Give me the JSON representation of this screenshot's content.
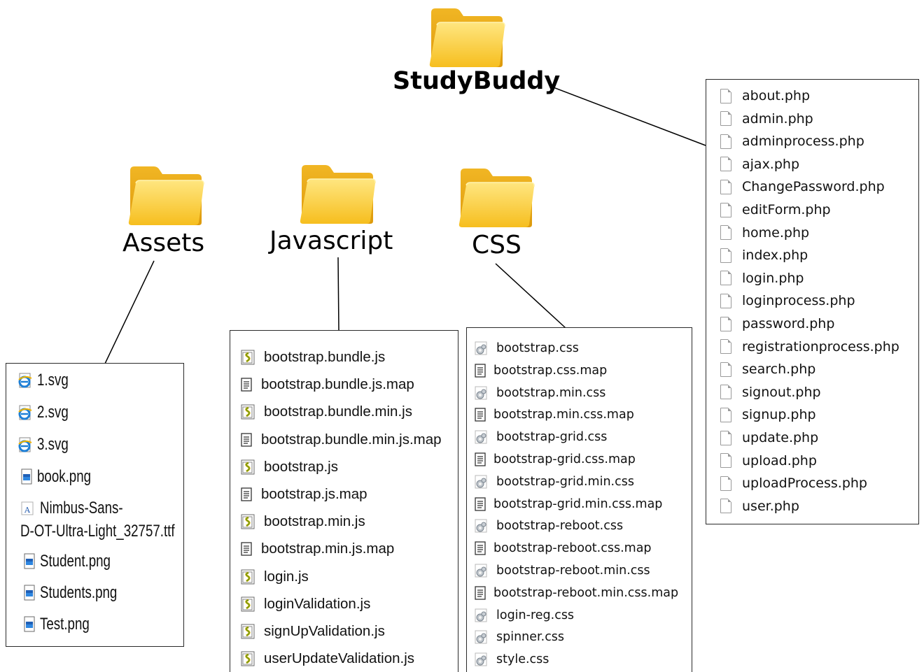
{
  "root": {
    "label": "StudyBuddy"
  },
  "folders": {
    "assets": {
      "label": "Assets"
    },
    "javascript": {
      "label": "Javascript"
    },
    "css": {
      "label": "CSS"
    }
  },
  "root_files": [
    "about.php",
    "admin.php",
    "adminprocess.php",
    "ajax.php",
    "ChangePassword.php",
    "editForm.php",
    "home.php",
    "index.php",
    "login.php",
    "loginprocess.php",
    "password.php",
    "registrationprocess.php",
    "search.php",
    "signout.php",
    "signup.php",
    "update.php",
    "upload.php",
    "uploadProcess.php",
    "user.php"
  ],
  "assets_files": [
    {
      "name": "1.svg",
      "icon": "ie-icon"
    },
    {
      "name": "2.svg",
      "icon": "ie-icon"
    },
    {
      "name": "3.svg",
      "icon": "ie-icon"
    },
    {
      "name": "book.png",
      "icon": "image-file-icon"
    },
    {
      "name": "Nimbus-Sans-",
      "icon": "font-file-icon"
    },
    {
      "name": "D-OT-Ultra-Light_32757.ttf",
      "icon": ""
    },
    {
      "name": "Student.png",
      "icon": "image-file-icon"
    },
    {
      "name": "Students.png",
      "icon": "image-file-icon"
    },
    {
      "name": "Test.png",
      "icon": "image-file-icon"
    }
  ],
  "js_files": [
    {
      "name": "bootstrap.bundle.js",
      "icon": "script-file-icon"
    },
    {
      "name": "bootstrap.bundle.js.map",
      "icon": "text-file-icon"
    },
    {
      "name": "bootstrap.bundle.min.js",
      "icon": "script-file-icon"
    },
    {
      "name": "bootstrap.bundle.min.js.map",
      "icon": "text-file-icon"
    },
    {
      "name": "bootstrap.js",
      "icon": "script-file-icon"
    },
    {
      "name": "bootstrap.js.map",
      "icon": "text-file-icon"
    },
    {
      "name": "bootstrap.min.js",
      "icon": "script-file-icon"
    },
    {
      "name": "bootstrap.min.js.map",
      "icon": "text-file-icon"
    },
    {
      "name": "login.js",
      "icon": "script-file-icon"
    },
    {
      "name": "loginValidation.js",
      "icon": "script-file-icon"
    },
    {
      "name": "signUpValidation.js",
      "icon": "script-file-icon"
    },
    {
      "name": "userUpdateValidation.js",
      "icon": "script-file-icon"
    }
  ],
  "css_files": [
    {
      "name": "bootstrap.css",
      "icon": "css-file-icon"
    },
    {
      "name": "bootstrap.css.map",
      "icon": "text-file-icon"
    },
    {
      "name": "bootstrap.min.css",
      "icon": "css-file-icon"
    },
    {
      "name": "bootstrap.min.css.map",
      "icon": "text-file-icon"
    },
    {
      "name": "bootstrap-grid.css",
      "icon": "css-file-icon"
    },
    {
      "name": "bootstrap-grid.css.map",
      "icon": "text-file-icon"
    },
    {
      "name": "bootstrap-grid.min.css",
      "icon": "css-file-icon"
    },
    {
      "name": "bootstrap-grid.min.css.map",
      "icon": "text-file-icon"
    },
    {
      "name": "bootstrap-reboot.css",
      "icon": "css-file-icon"
    },
    {
      "name": "bootstrap-reboot.css.map",
      "icon": "text-file-icon"
    },
    {
      "name": "bootstrap-reboot.min.css",
      "icon": "css-file-icon"
    },
    {
      "name": "bootstrap-reboot.min.css.map",
      "icon": "text-file-icon"
    },
    {
      "name": "login-reg.css",
      "icon": "css-file-icon"
    },
    {
      "name": "spinner.css",
      "icon": "css-file-icon"
    },
    {
      "name": "style.css",
      "icon": "css-file-icon"
    }
  ],
  "colors": {
    "folder_back": "#e9a810",
    "folder_front": "#ffd54a",
    "line": "#000000",
    "box_border": "#2a2a2a"
  }
}
